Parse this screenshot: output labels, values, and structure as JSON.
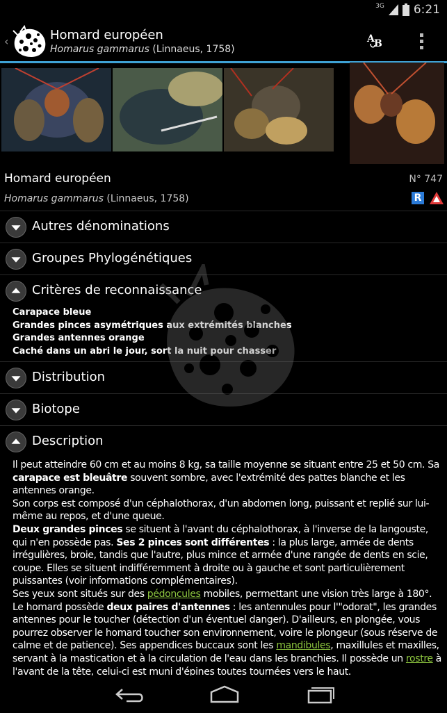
{
  "status_bar": {
    "network": "3G",
    "time": "6:21"
  },
  "action_bar": {
    "title": "Homard européen",
    "subtitle_latin": "Homarus gammarus",
    "subtitle_author": " (Linnaeus, 1758)",
    "text_size_icon": "AB",
    "menu_icon": "overflow-icon"
  },
  "gallery": {
    "count": 4
  },
  "species": {
    "name": "Homard européen",
    "latin": "Homarus gammarus",
    "author": " (Linnaeus, 1758)",
    "number": "N° 747",
    "badge_r": "R"
  },
  "sections": {
    "other_names": "Autres dénominations",
    "phylo": "Groupes Phylogénétiques",
    "criteria": "Critères de reconnaissance",
    "distribution": "Distribution",
    "biotope": "Biotope",
    "description": "Description"
  },
  "criteria": [
    "Carapace bleue",
    "Grandes pinces asymétriques aux extrémités blanches",
    "Grandes antennes orange",
    "Caché dans un abri le jour, sort la nuit pour chasser"
  ],
  "description": {
    "p1a": "Il peut atteindre 60 cm et au moins 8 kg, sa taille moyenne se situant entre 25 et 50 cm. Sa ",
    "p1b": "carapace est bleuâtre",
    "p1c": " souvent sombre, avec l'extrémité des pattes blanche et les antennes orange.",
    "p2": "Son corps est composé d'un céphalothorax, d'un abdomen long, puissant et replié sur lui-même au repos, et d'une queue.",
    "p3a": "Deux grandes pinces",
    "p3b": " se situent à l'avant du céphalothorax, à l'inverse de la langouste, qui n'en possède pas. ",
    "p3c": "Ses 2 pinces sont différentes",
    "p3d": " : la plus large, armée de dents irrégulières, broie, tandis que l'autre, plus mince et armée d'une rangée de dents en scie, coupe. Elles se situent indifféremment à droite ou à gauche et sont particulièrement puissantes (voir informations complémentaires).",
    "p4a": "Ses yeux sont situés sur des ",
    "p4link": "pédoncules",
    "p4b": " mobiles, permettant une vision très large à 180°.",
    "p5a": "Le homard possède ",
    "p5b": "deux paires d'antennes",
    "p5c": " : les antennules pour l'\"odorat\", les grandes antennes pour le toucher (détection d'un éventuel danger). D'ailleurs, en plongée, vous pourrez observer le homard toucher son environnement, voire le plongeur (sous réserve de calme et de patience). Ses appendices buccaux sont les ",
    "p5link": "mandibules",
    "p5d": ", maxillules et maxilles, servant à la mastication et à la circulation de l'eau dans les branchies. Il possède un ",
    "p5link2": "rostre",
    "p5e": " à l'avant de la tête, celui-ci est muni d'épines toutes tournées vers le haut."
  },
  "nav": {
    "back": "back-icon",
    "home": "home-icon",
    "recents": "recents-icon"
  },
  "colors": {
    "accent": "#3ea1d4",
    "link": "#8dc63f",
    "badge": "#2b7bd8",
    "warning": "#e03a3a"
  }
}
